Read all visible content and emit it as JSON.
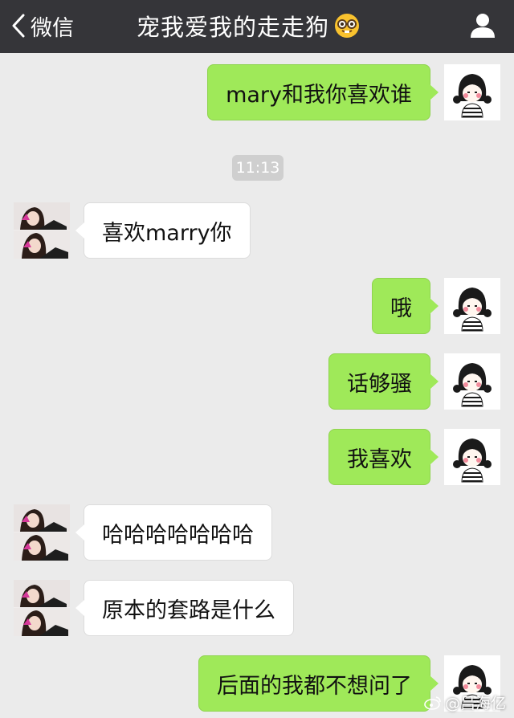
{
  "navbar": {
    "back_label": "微信",
    "title": "宠我爱我的走走狗",
    "title_emoji": "nerd-face-emoji",
    "right_icon": "person-icon",
    "background": "#353539"
  },
  "timestamp": "11:13",
  "messages": [
    {
      "side": "right",
      "text": "mary和我你喜欢谁"
    },
    {
      "side": "left",
      "text": "喜欢marry你"
    },
    {
      "side": "right",
      "text": "哦"
    },
    {
      "side": "right",
      "text": "话够骚"
    },
    {
      "side": "right",
      "text": "我喜欢"
    },
    {
      "side": "left",
      "text": "哈哈哈哈哈哈哈"
    },
    {
      "side": "left",
      "text": "原本的套路是什么"
    },
    {
      "side": "right",
      "text": "后面的我都不想问了"
    }
  ],
  "watermark": {
    "icon": "weibo-icon",
    "text": "@吕海亿"
  },
  "colors": {
    "sent_bubble": "#9fe959",
    "received_bubble": "#ffffff",
    "background": "#ebebeb"
  }
}
